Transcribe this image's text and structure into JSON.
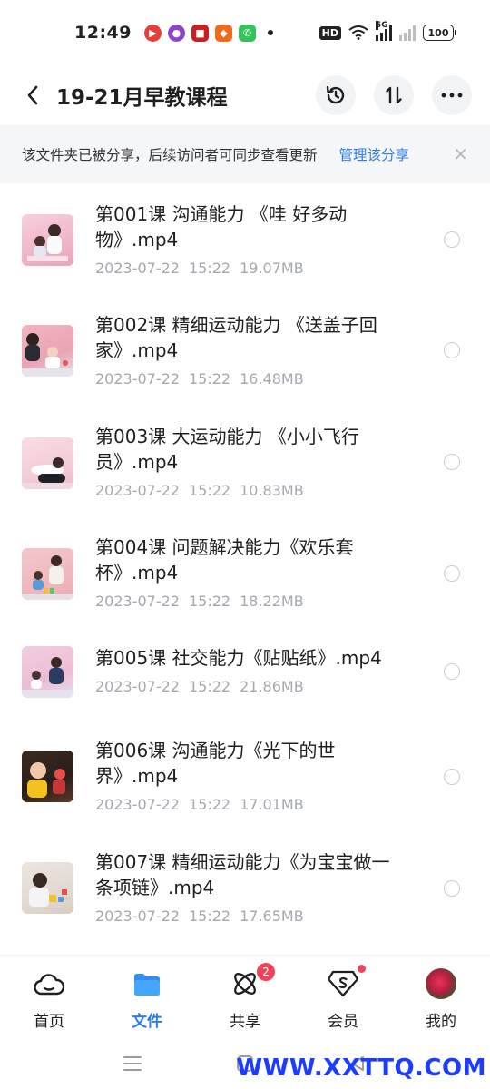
{
  "status_bar": {
    "time": "12:49",
    "hd": "HD",
    "net": "5G",
    "battery": "100"
  },
  "header": {
    "title": "19-21月早教课程",
    "actions": [
      "history-icon",
      "sort-icon",
      "more-icon"
    ]
  },
  "banner": {
    "text": "该文件夹已被分享，后续访问者可同步查看更新",
    "link": "管理该分享"
  },
  "files": [
    {
      "name": "第001课 沟通能力 《哇 好多动物》.mp4",
      "date": "2023-07-22",
      "time": "15:22",
      "size": "19.07MB",
      "thumb_color": "#f4c6d6"
    },
    {
      "name": "第002课 精细运动能力 《送盖子回家》.mp4",
      "date": "2023-07-22",
      "time": "15:22",
      "size": "16.48MB",
      "thumb_color": "#f2b9c6"
    },
    {
      "name": "第003课 大运动能力 《小小飞行员》.mp4",
      "date": "2023-07-22",
      "time": "15:22",
      "size": "10.83MB",
      "thumb_color": "#f6d2dc"
    },
    {
      "name": "第004课 问题解决能力《欢乐套杯》.mp4",
      "date": "2023-07-22",
      "time": "15:22",
      "size": "18.22MB",
      "thumb_color": "#f0c4c8"
    },
    {
      "name": "第005课 社交能力《贴贴纸》.mp4",
      "date": "2023-07-22",
      "time": "15:22",
      "size": "21.86MB",
      "thumb_color": "#eec4dc"
    },
    {
      "name": "第006课 沟通能力《光下的世界》.mp4",
      "date": "2023-07-22",
      "time": "15:22",
      "size": "17.01MB",
      "thumb_color": "#3a2a22"
    },
    {
      "name": "第007课 精细运动能力《为宝宝做一条项链》.mp4",
      "date": "2023-07-22",
      "time": "15:22",
      "size": "17.65MB",
      "thumb_color": "#e8e2dc"
    }
  ],
  "bottom_nav": [
    {
      "label": "首页",
      "icon": "cloud-icon"
    },
    {
      "label": "文件",
      "icon": "folder-icon",
      "active": true
    },
    {
      "label": "共享",
      "icon": "atom-share-icon",
      "badge": "2"
    },
    {
      "label": "会员",
      "icon": "diamond-vip-icon",
      "dot": true
    },
    {
      "label": "我的",
      "icon": "avatar"
    }
  ],
  "watermark": "WWW.XXTTQ.COM",
  "colors": {
    "accent": "#2a7dee",
    "badge": "#f0435a",
    "meta_text": "#a4a8b0",
    "banner_bg": "#f5f6f8"
  }
}
